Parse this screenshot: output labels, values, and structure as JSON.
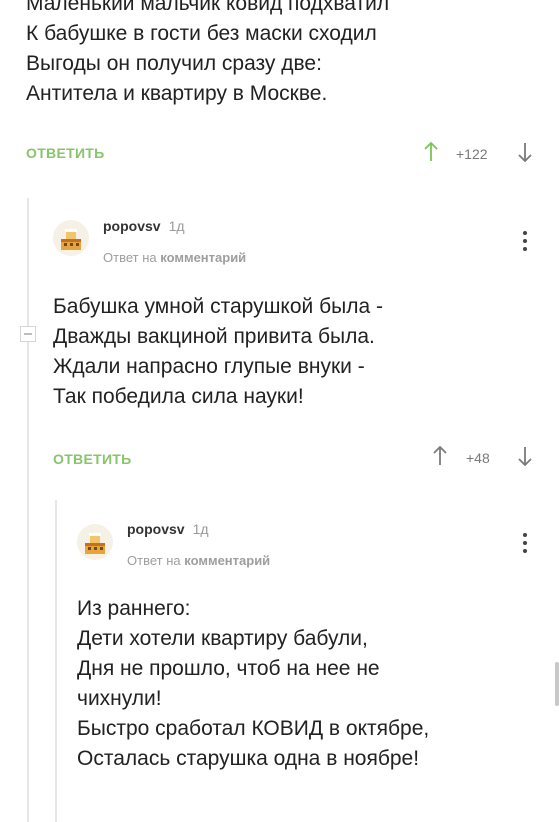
{
  "comment_top": {
    "lines": [
      "Маленький мальчик ковид подхватил",
      "К бабушке в гости без маски сходил",
      "Выгоды он получил сразу две:",
      "Антитела и квартиру в Москве."
    ],
    "reply_label": "ОТВЕТИТЬ",
    "votes": "+122"
  },
  "comment_reply1": {
    "username": "popovsv",
    "time": "1д",
    "reply_to_prefix": "Ответ на",
    "reply_to_link": "комментарий",
    "lines": [
      "Бабушка умной старушкой была -",
      "Дважды вакциной привита была.",
      "Ждали напрасно глупые внуки -",
      "Так победила сила науки!"
    ],
    "reply_label": "ОТВЕТИТЬ",
    "votes": "+48"
  },
  "comment_reply2": {
    "username": "popovsv",
    "time": "1д",
    "reply_to_prefix": "Ответ на",
    "reply_to_link": "комментарий",
    "lines": [
      "Из раннего:",
      "Дети хотели квартиру бабули,",
      "Дня не прошло, чтоб на нее не",
      "чихнули!",
      "Быстро сработал КОВИД в октябре,",
      "Осталась старушка одна в ноябре!"
    ]
  },
  "colors": {
    "accent_green": "#87c46b",
    "text": "#222222",
    "muted": "#9e9e9e"
  }
}
